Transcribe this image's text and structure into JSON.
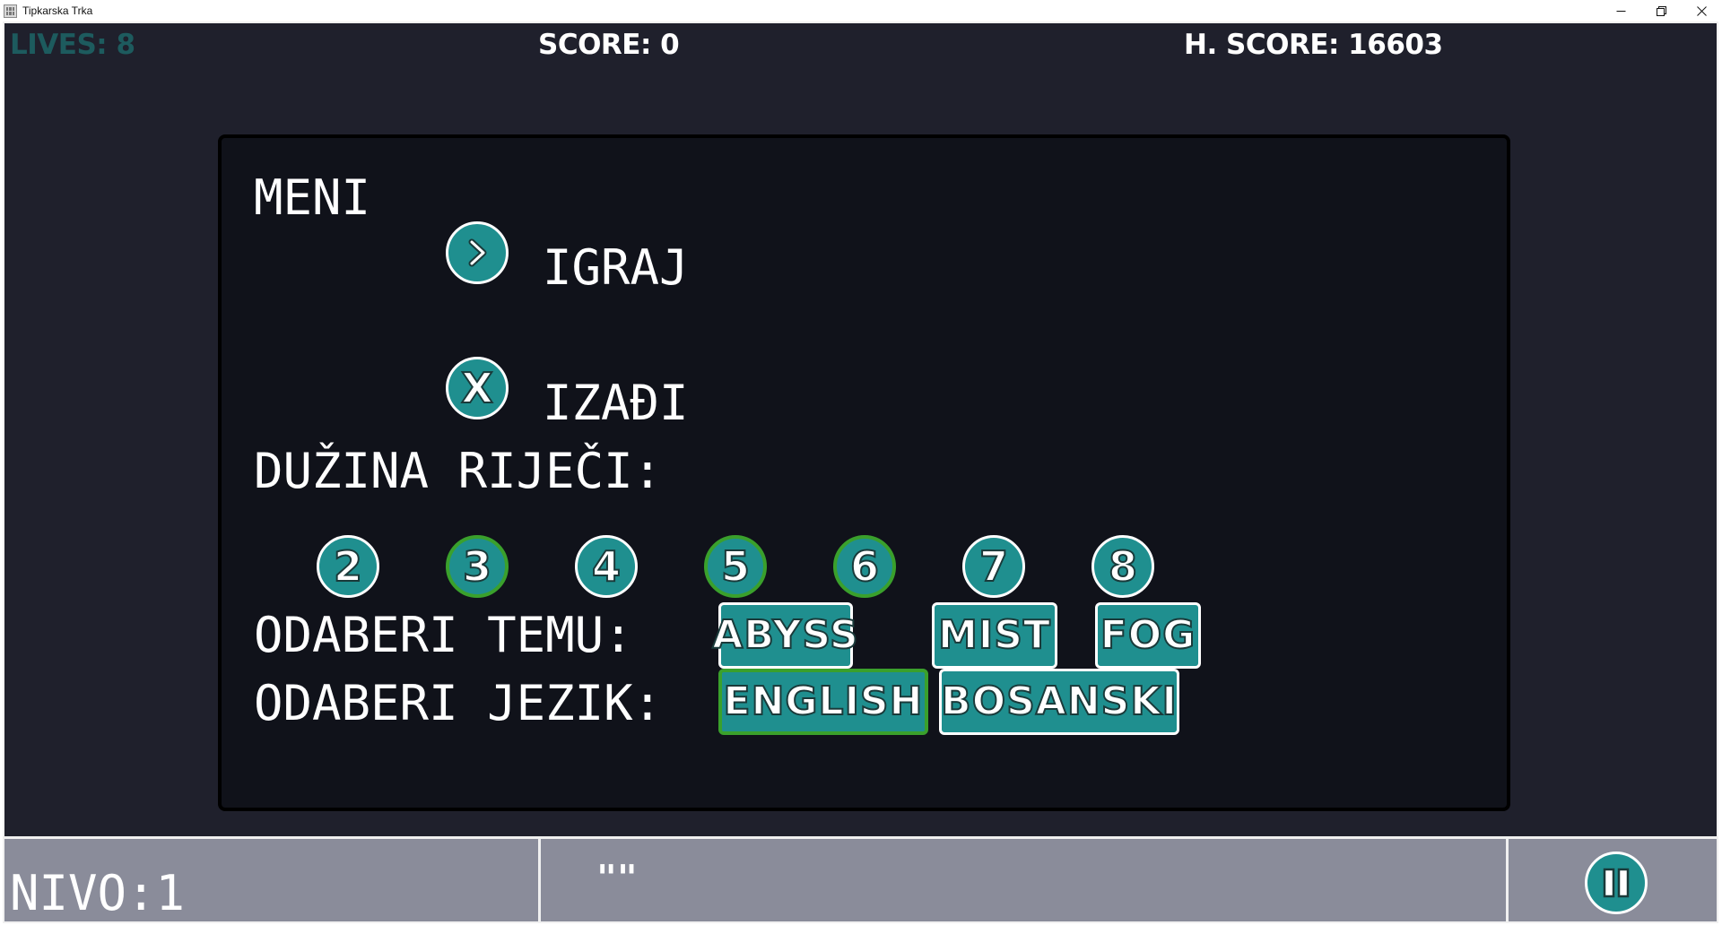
{
  "window": {
    "title": "Tipkarska Trka"
  },
  "hud": {
    "lives": "LIVES: 8",
    "score": "SCORE: 0",
    "high_score": "H. SCORE: 16603"
  },
  "menu": {
    "heading": "MENI",
    "play_label": "IGRAJ",
    "play_icon": "chevron-right-icon",
    "exit_label": "IZAĐI",
    "exit_icon_glyph": "X",
    "word_length_label": "DUŽINA RIJEČI:",
    "word_lengths": [
      "2",
      "3",
      "4",
      "5",
      "6",
      "7",
      "8"
    ],
    "selected_word_lengths": [
      "3",
      "5",
      "6"
    ],
    "theme_label": "ODABERI TEMU:",
    "themes": [
      "ABYSS",
      "MIST",
      "FOG"
    ],
    "language_label": "ODABERI JEZIK:",
    "languages": [
      "ENGLISH",
      "BOSANSKI"
    ],
    "selected_language": "ENGLISH"
  },
  "bottom_bar": {
    "level": "NIVO:1",
    "typed_word": "\"\"",
    "pause_icon": "pause-icon"
  },
  "colors": {
    "background": "#1f202c",
    "panel": "#10121a",
    "button_fill": "#1f8f8f",
    "selected_border": "#3aa02c",
    "lives_text": "#1d5b5e",
    "bottom_bar": "#8a8c9a"
  }
}
